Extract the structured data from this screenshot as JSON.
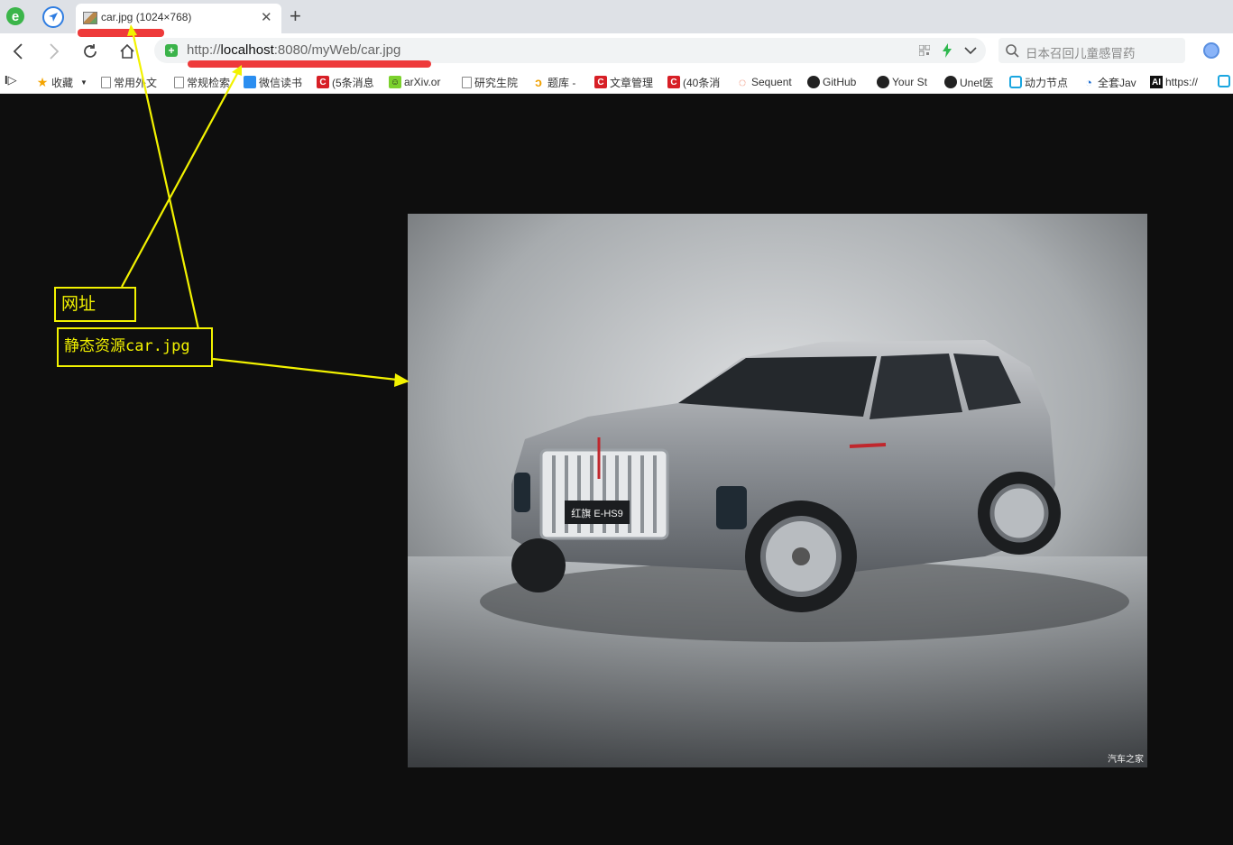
{
  "tab": {
    "title": "car.jpg (1024×768)"
  },
  "address": {
    "scheme": "http://",
    "host": "localhost",
    "rest": ":8080/myWeb/car.jpg"
  },
  "search": {
    "placeholder": "日本召回儿童感冒药"
  },
  "bookmarks": [
    {
      "label": "收藏",
      "icon": "star-icon"
    },
    {
      "label": "常用外文",
      "icon": "page-icon"
    },
    {
      "label": "常规检索",
      "icon": "page-icon"
    },
    {
      "label": "微信读书",
      "icon": "weread-icon"
    },
    {
      "label": "(5条消息",
      "icon": "csdn-icon"
    },
    {
      "label": "arXiv.or",
      "icon": "arxiv-icon"
    },
    {
      "label": "研究生院",
      "icon": "page-icon"
    },
    {
      "label": "题库 -",
      "icon": "leetcode-icon"
    },
    {
      "label": "文章管理",
      "icon": "csdn-icon"
    },
    {
      "label": "(40条消",
      "icon": "csdn-icon"
    },
    {
      "label": "Sequent",
      "icon": "drop-icon"
    },
    {
      "label": "GitHub",
      "icon": "github-icon"
    },
    {
      "label": "Your St",
      "icon": "github-icon"
    },
    {
      "label": "Unet医",
      "icon": "github-icon"
    },
    {
      "label": "动力节点",
      "icon": "bilibili-icon"
    },
    {
      "label": "全套Jav",
      "icon": "edu-icon"
    },
    {
      "label": "https://",
      "icon": "ai-icon"
    }
  ],
  "image": {
    "plate_text": "红旗 E-HS9",
    "watermark": "汽车之家"
  },
  "annotations": {
    "url_label": "网址",
    "resource_label": "静态资源car.jpg"
  },
  "colors": {
    "annotation": "#f2f200",
    "underline": "#ee3a3a",
    "background": "#0e0e0e"
  }
}
